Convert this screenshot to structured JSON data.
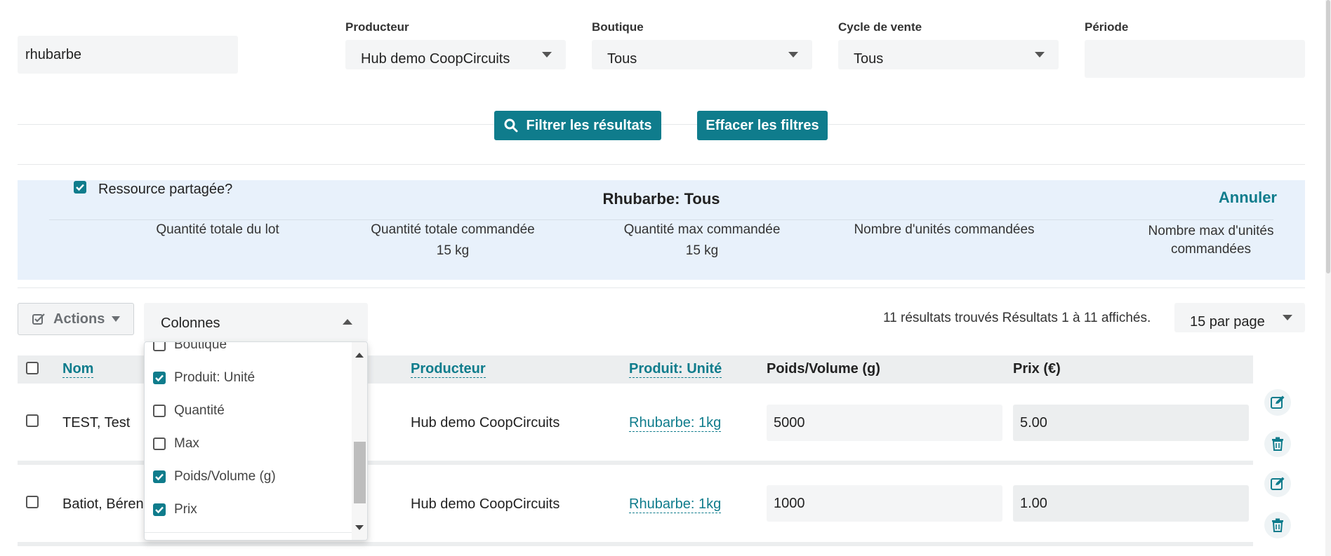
{
  "filters": {
    "search_value": "rhubarbe",
    "producer": {
      "label": "Producteur",
      "value": "Hub demo CoopCircuits"
    },
    "shop": {
      "label": "Boutique",
      "value": "Tous"
    },
    "cycle": {
      "label": "Cycle de vente",
      "value": "Tous"
    },
    "period": {
      "label": "Période",
      "value": ""
    },
    "filter_button": "Filtrer les résultats",
    "clear_button": "Effacer les filtres"
  },
  "summary": {
    "shared_label": "Ressource partagée?",
    "shared_checked": true,
    "title": "Rhubarbe: Tous",
    "cancel_link": "Annuler",
    "columns": [
      {
        "label": "Quantité totale du lot",
        "value": ""
      },
      {
        "label": "Quantité totale commandée",
        "value": "15 kg"
      },
      {
        "label": "Quantité max commandée",
        "value": "15 kg"
      },
      {
        "label": "Nombre d'unités commandées",
        "value": ""
      },
      {
        "label": "Nombre max d'unités commandées",
        "value": ""
      }
    ]
  },
  "toolbar": {
    "actions_label": "Actions",
    "columns_label": "Colonnes",
    "results_text": "11 résultats trouvés Résultats 1 à 11 affichés.",
    "per_page": "15 par page"
  },
  "columns_dropdown": {
    "items": [
      {
        "label": "Boutique",
        "checked": false
      },
      {
        "label": "Produit: Unité",
        "checked": true
      },
      {
        "label": "Quantité",
        "checked": false
      },
      {
        "label": "Max",
        "checked": false
      },
      {
        "label": "Poids/Volume (g)",
        "checked": true
      },
      {
        "label": "Prix",
        "checked": true
      }
    ]
  },
  "table": {
    "headers": {
      "name": "Nom",
      "producer": "Producteur",
      "unit": "Produit: Unité",
      "weight": "Poids/Volume (g)",
      "price": "Prix (€)"
    },
    "rows": [
      {
        "name": "TEST, Test",
        "producer": "Hub demo CoopCircuits",
        "unit": "Rhubarbe: 1kg",
        "weight": "5000",
        "price": "5.00"
      },
      {
        "name": "Batiot, Béren",
        "producer": "Hub demo CoopCircuits",
        "unit": "Rhubarbe: 1kg",
        "weight": "1000",
        "price": "1.00"
      }
    ]
  },
  "colors": {
    "accent": "#0f7c8c",
    "panel": "#e8f1fb"
  }
}
